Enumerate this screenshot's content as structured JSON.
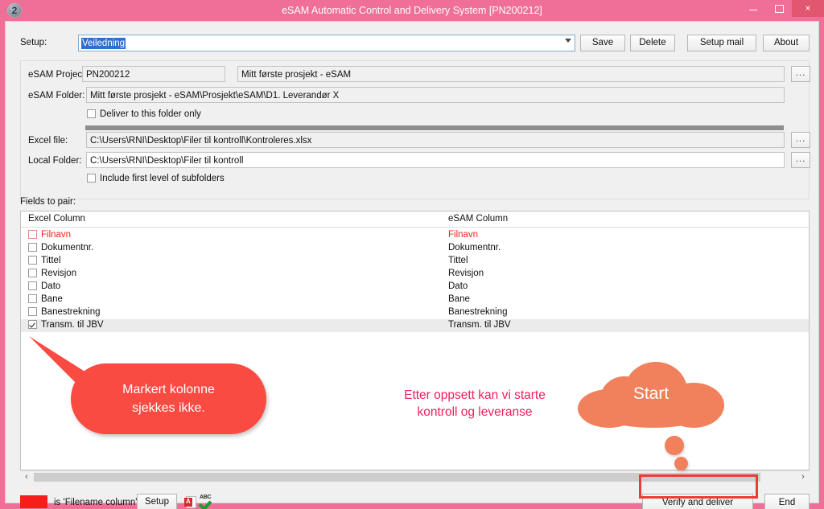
{
  "window": {
    "title": "eSAM Automatic Control and Delivery System [PN200212]",
    "icon_label": "2",
    "minimize_label": "minimize",
    "maximize_label": "maximize",
    "close_label": "×",
    "titlebar_color": "#ef6f98",
    "close_color": "#e0576f"
  },
  "setup": {
    "label": "Setup:",
    "value": "Veiledning",
    "save_label": "Save",
    "delete_label": "Delete",
    "setup_mail_label": "Setup mail",
    "about_label": "About"
  },
  "fields": {
    "esam_project_label": "eSAM Project:",
    "esam_project_code": "PN200212",
    "esam_project_name": "Mitt første prosjekt - eSAM",
    "esam_folder_label": "eSAM Folder:",
    "esam_folder_value": "Mitt første prosjekt - eSAM\\Prosjekt\\eSAM\\D1. Leverandør X",
    "deliver_only_label": "Deliver to this folder only",
    "deliver_only_checked": false,
    "excel_file_label": "Excel file:",
    "excel_file_value": "C:\\Users\\RNI\\Desktop\\Filer til kontroll\\Kontroleres.xlsx",
    "local_folder_label": "Local Folder:",
    "local_folder_value": "C:\\Users\\RNI\\Desktop\\Filer til kontroll",
    "include_subfolders_label": "Include first level of subfolders",
    "include_subfolders_checked": false,
    "browse_label": "..."
  },
  "pairing": {
    "section_label": "Fields to pair:",
    "col_excel": "Excel Column",
    "col_esam": "eSAM Column",
    "rows": [
      {
        "excel": "Filnavn",
        "esam": "Filnavn",
        "checked": false,
        "highlight": true
      },
      {
        "excel": "Dokumentnr.",
        "esam": "Dokumentnr.",
        "checked": false,
        "highlight": false
      },
      {
        "excel": "Tittel",
        "esam": "Tittel",
        "checked": false,
        "highlight": false
      },
      {
        "excel": "Revisjon",
        "esam": "Revisjon",
        "checked": false,
        "highlight": false
      },
      {
        "excel": "Dato",
        "esam": "Dato",
        "checked": false,
        "highlight": false
      },
      {
        "excel": "Bane",
        "esam": "Bane",
        "checked": false,
        "highlight": false
      },
      {
        "excel": "Banestrekning",
        "esam": "Banestrekning",
        "checked": false,
        "highlight": false
      },
      {
        "excel": "Transm. til JBV",
        "esam": "Transm. til JBV",
        "checked": true,
        "highlight": false
      }
    ],
    "scroll_left": "‹",
    "scroll_right": "›"
  },
  "statusbar": {
    "swatch_color": "#f71d1d",
    "swatch_text": "is 'Filename column'",
    "setup_label": "Setup",
    "pdf_icon": "pdf-icon",
    "spellcheck_icon": "spellcheck-icon",
    "verify_label": "Verify and deliver",
    "end_label": "End"
  },
  "annotations": {
    "balloon_line1": "Markert kolonne",
    "balloon_line2": "sjekkes ikke.",
    "balloon_color": "#fa4b43",
    "center_line1": "Etter oppsett kan vi starte",
    "center_line2": "kontroll og leveranse",
    "center_color": "#ee1f5a",
    "cloud_label": "Start",
    "cloud_color": "#f0815c",
    "highlight_color": "#ef3b33"
  }
}
